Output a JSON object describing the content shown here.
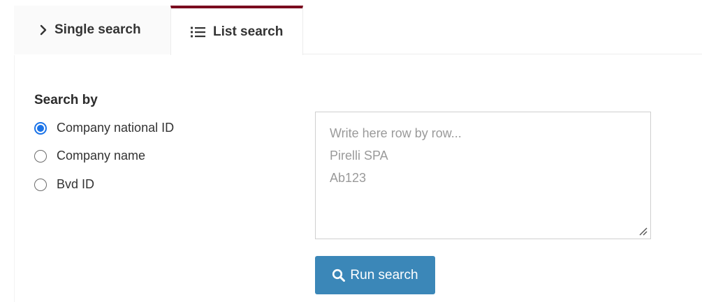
{
  "tabs": [
    {
      "label": "Single search",
      "icon": "chevron-right-icon",
      "active": false
    },
    {
      "label": "List search",
      "icon": "list-icon",
      "active": true
    }
  ],
  "search_by": {
    "title": "Search by",
    "options": [
      {
        "label": "Company national ID",
        "selected": true
      },
      {
        "label": "Company name",
        "selected": false
      },
      {
        "label": "Bvd ID",
        "selected": false
      }
    ]
  },
  "list_input": {
    "value": "",
    "placeholder": "Write here row by row...\nPirelli SPA\nAb123"
  },
  "run_button": {
    "label": "Run search",
    "icon": "search-icon"
  },
  "colors": {
    "active_tab_accent": "#7a0c1e",
    "radio_selected": "#1a73e8",
    "button_bg": "#3b87b8"
  }
}
